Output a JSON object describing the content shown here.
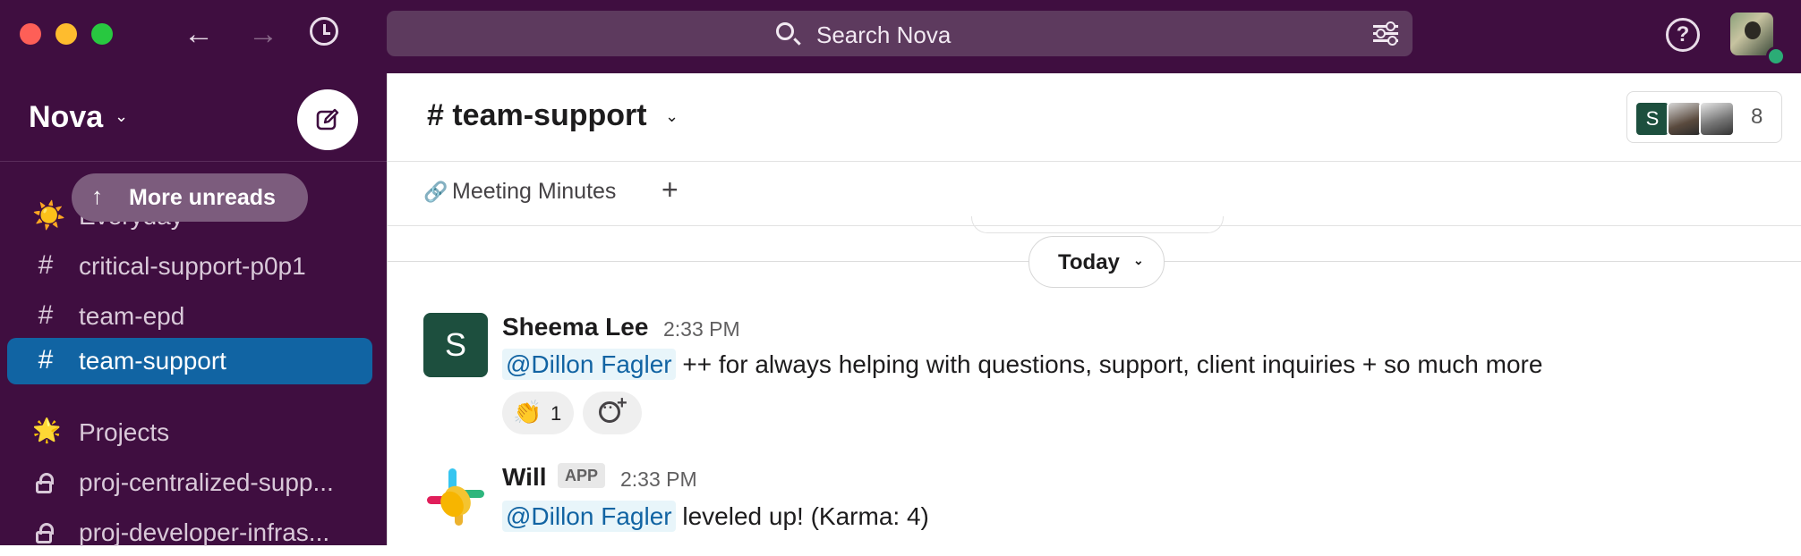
{
  "titlebar": {
    "search_placeholder": "Search Nova",
    "traffic_colors": [
      "#fe5f57",
      "#febc2e",
      "#28c840"
    ],
    "back_glyph": "←",
    "forward_glyph": "→",
    "help_glyph": "?"
  },
  "sidebar": {
    "workspace_name": "Nova",
    "more_unreads": "More unreads",
    "items": [
      {
        "icon": "sun-emoji",
        "glyph": "☀️",
        "label": "Everyday"
      },
      {
        "icon": "hash-icon",
        "glyph": "#",
        "label": "critical-support-p0p1"
      },
      {
        "icon": "hash-icon",
        "glyph": "#",
        "label": "team-epd"
      },
      {
        "icon": "hash-icon",
        "glyph": "#",
        "label": "team-support",
        "active": true
      },
      {
        "icon": "star-emoji",
        "glyph": "🌟",
        "label": "Projects"
      },
      {
        "icon": "lock-icon",
        "glyph": "",
        "label": "proj-centralized-supp..."
      },
      {
        "icon": "lock-icon",
        "glyph": "",
        "label": "proj-developer-infras..."
      }
    ]
  },
  "channel": {
    "title": "# team-support",
    "member_initial": "S",
    "member_count": "8",
    "bookmark": "Meeting Minutes",
    "add_bookmark": "+",
    "day_divider": "Today"
  },
  "messages": [
    {
      "avatar_initial": "S",
      "sender": "Sheema Lee",
      "time": "2:33 PM",
      "mention": "@Dillon Fagler",
      "text": " ++ for always helping with questions, support, client inquiries + so much more",
      "reaction_emoji": "👏",
      "reaction_count": "1"
    },
    {
      "sender": "Will",
      "badge": "APP",
      "time": "2:33 PM",
      "mention": "@Dillon Fagler",
      "text": " leveled up! (Karma: 4)"
    }
  ]
}
